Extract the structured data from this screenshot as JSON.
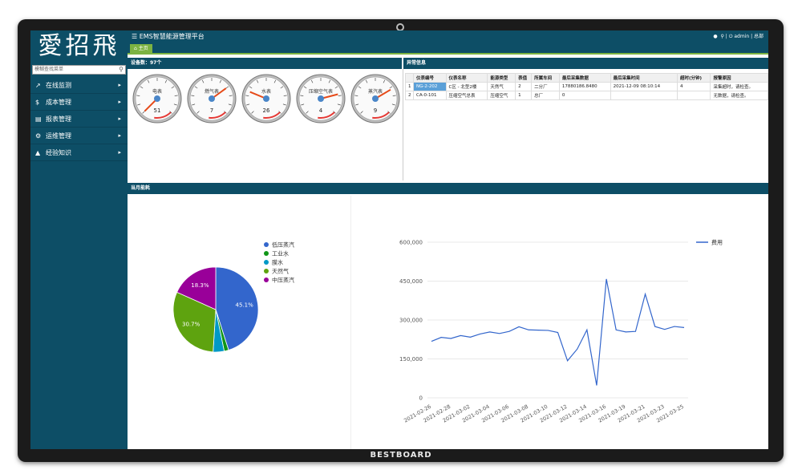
{
  "app": {
    "logo": "愛招飛",
    "title": "EMS智慧能源管理平台",
    "user": "admin | 总部",
    "brand": "BESTBOARD"
  },
  "search": {
    "placeholder": "模糊查找菜单"
  },
  "menu": [
    {
      "label": "在线监测",
      "icon": "chart-line-icon"
    },
    {
      "label": "成本管理",
      "icon": "dollar-icon"
    },
    {
      "label": "报表管理",
      "icon": "bar-chart-icon"
    },
    {
      "label": "运维管理",
      "icon": "gear-icon"
    },
    {
      "label": "经验知识",
      "icon": "graduation-cap-icon"
    }
  ],
  "tabs": [
    {
      "label": "主页",
      "icon": "home-icon"
    }
  ],
  "devices": {
    "header": "设备数：97个",
    "gauges": [
      {
        "name": "电表",
        "value": 51,
        "needle": 0.0
      },
      {
        "name": "燃气表",
        "value": 7,
        "needle": 0.7
      },
      {
        "name": "水表",
        "value": 26,
        "needle": 0.25
      },
      {
        "name": "压缩空气表",
        "value": 4,
        "needle": 0.78
      },
      {
        "name": "蒸汽表",
        "value": 9,
        "needle": 0.72
      }
    ]
  },
  "abnormal": {
    "header": "异常信息",
    "columns": [
      "",
      "仪表编号",
      "仪表名称",
      "能源类型",
      "表值",
      "所属车间",
      "最后采集数据",
      "最后采集时间",
      "超时(分钟)",
      "报警原因"
    ],
    "rows": [
      [
        "1",
        "NG-2-202",
        "C区 - 北型2楼",
        "天然气",
        "2",
        "二分厂",
        "17880186.8480",
        "2021-12-09 08:10:14",
        "4",
        "采集超时，请检查。"
      ],
      [
        "2",
        "CA-0-101",
        "压缩空气总表",
        "压缩空气",
        "1",
        "总厂",
        "0",
        "",
        "",
        "无数据，请检查。"
      ]
    ]
  },
  "monthly": {
    "header": "当月能耗"
  },
  "chart_data": [
    {
      "type": "pie",
      "legend": [
        "低压蒸汽",
        "工业水",
        "膜水",
        "天然气",
        "中压蒸汽"
      ],
      "values": [
        45.1,
        1.7,
        4.2,
        30.7,
        18.3
      ],
      "labels": [
        "45.1%",
        "",
        "",
        "30.7%",
        "18.3%"
      ],
      "colors": [
        "#3366cc",
        "#109618",
        "#0099c6",
        "#5ea30f",
        "#990099"
      ],
      "legend_position": "right"
    },
    {
      "type": "line",
      "series": [
        {
          "name": "费用",
          "values": [
            218000,
            233000,
            229000,
            240000,
            234000,
            246000,
            254000,
            248000,
            256000,
            274000,
            262000,
            261000,
            260000,
            252000,
            143000,
            188000,
            262000,
            48000,
            458000,
            262000,
            254000,
            256000,
            400000,
            275000,
            264000,
            275000,
            271000
          ]
        }
      ],
      "x_ticks": [
        "2021-02-26",
        "2021-02-28",
        "2021-03-02",
        "2021-03-04",
        "2021-03-06",
        "2021-03-08",
        "2021-03-10",
        "2021-03-12",
        "2021-03-14",
        "2021-03-16",
        "2021-03-19",
        "2021-03-21",
        "2021-03-23",
        "2021-03-25"
      ],
      "y_ticks": [
        "0",
        "150,000",
        "300,000",
        "450,000",
        "600,000"
      ],
      "ylim": [
        0,
        600000
      ],
      "color": "#3366cc",
      "grid": true,
      "legend_position": "top-right"
    }
  ]
}
